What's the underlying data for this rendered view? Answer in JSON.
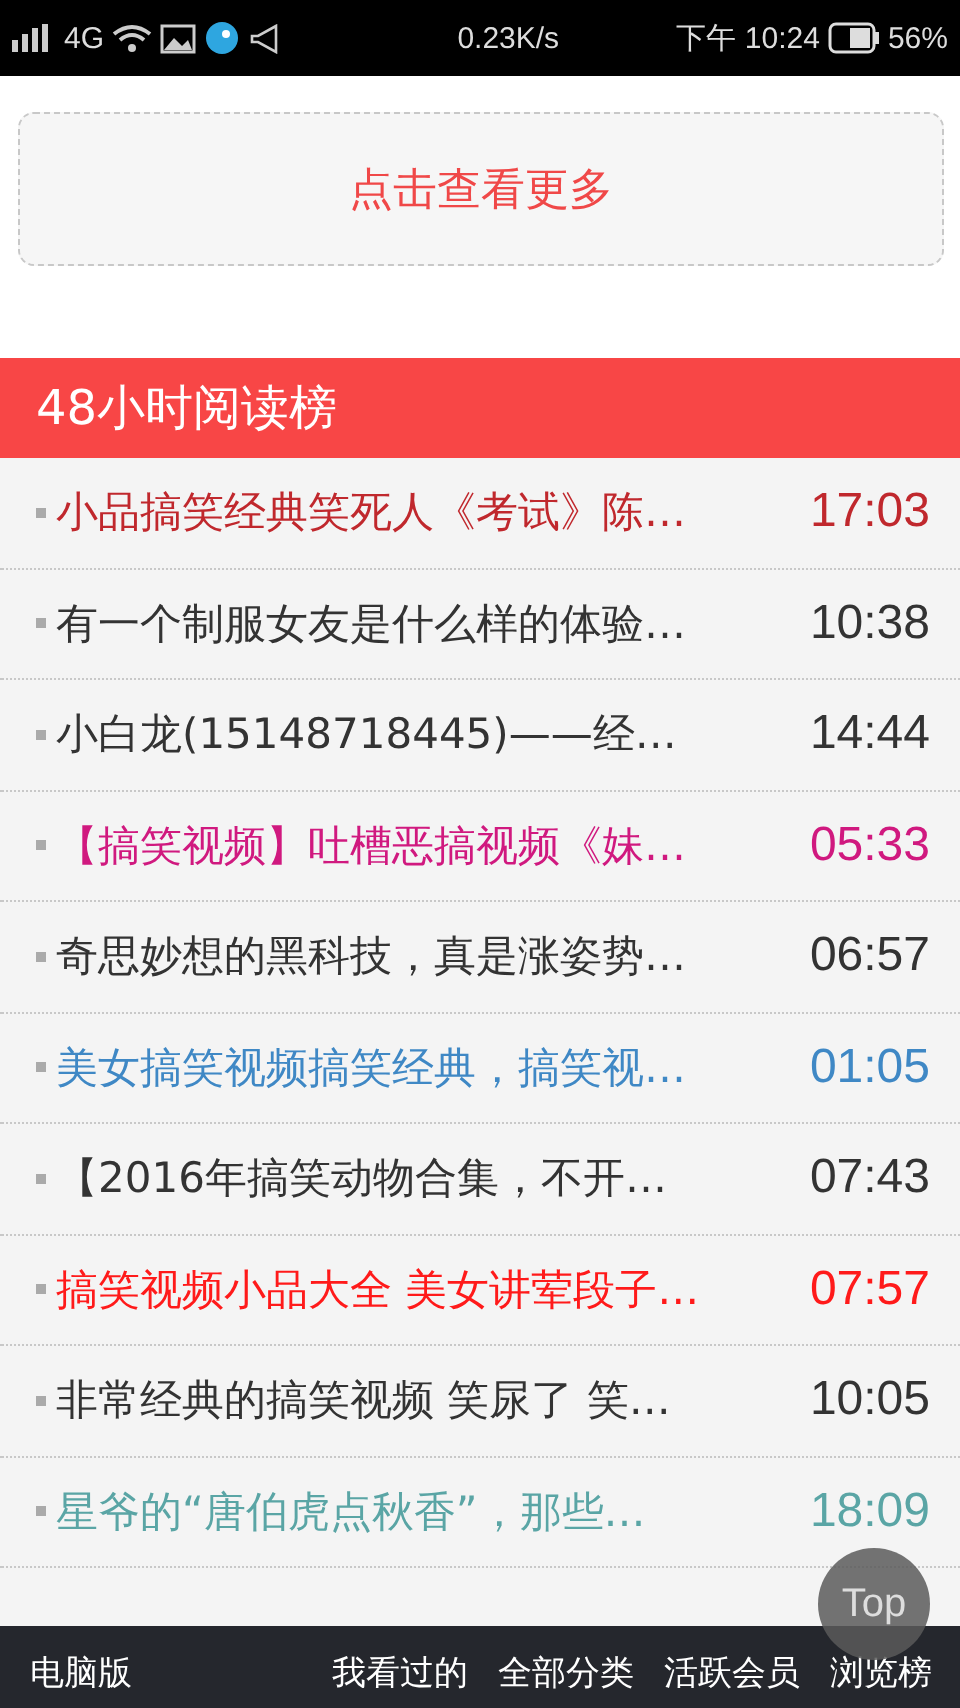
{
  "status_bar": {
    "network": "4G",
    "speed": "0.23K/s",
    "time": "下午 10:24",
    "battery": "56%"
  },
  "more_button": {
    "label": "点击查看更多"
  },
  "ranking": {
    "title": "48小时阅读榜",
    "items": [
      {
        "title": "小品搞笑经典笑死人《考试》陈…",
        "time": "17:03",
        "color": "#c0282d"
      },
      {
        "title": "有一个制服女友是什么样的体验…",
        "time": "10:38",
        "color": "#333333"
      },
      {
        "title": "小白龙(15148718445)——经…",
        "time": "14:44",
        "color": "#333333"
      },
      {
        "title": "【搞笑视频】吐槽恶搞视频《妹…",
        "time": "05:33",
        "color": "#d0197f"
      },
      {
        "title": "奇思妙想的黑科技，真是涨姿势…",
        "time": "06:57",
        "color": "#333333"
      },
      {
        "title": "美女搞笑视频搞笑经典，搞笑视…",
        "time": "01:05",
        "color": "#3f88c5"
      },
      {
        "title": "【2016年搞笑动物合集，不开…",
        "time": "07:43",
        "color": "#333333"
      },
      {
        "title": "搞笑视频小品大全 美女讲荤段子…",
        "time": "07:57",
        "color": "#ff1a1a"
      },
      {
        "title": "非常经典的搞笑视频 笑尿了 笑…",
        "time": "10:05",
        "color": "#333333"
      },
      {
        "title": "星爷的“唐伯虎点秋香”，那些…",
        "time": "18:09",
        "color": "#5aa5a5"
      }
    ]
  },
  "top_button": {
    "label": "Top"
  },
  "footer": {
    "left": "电脑版",
    "links": [
      "我看过的",
      "全部分类",
      "活跃会员",
      "浏览榜"
    ]
  }
}
